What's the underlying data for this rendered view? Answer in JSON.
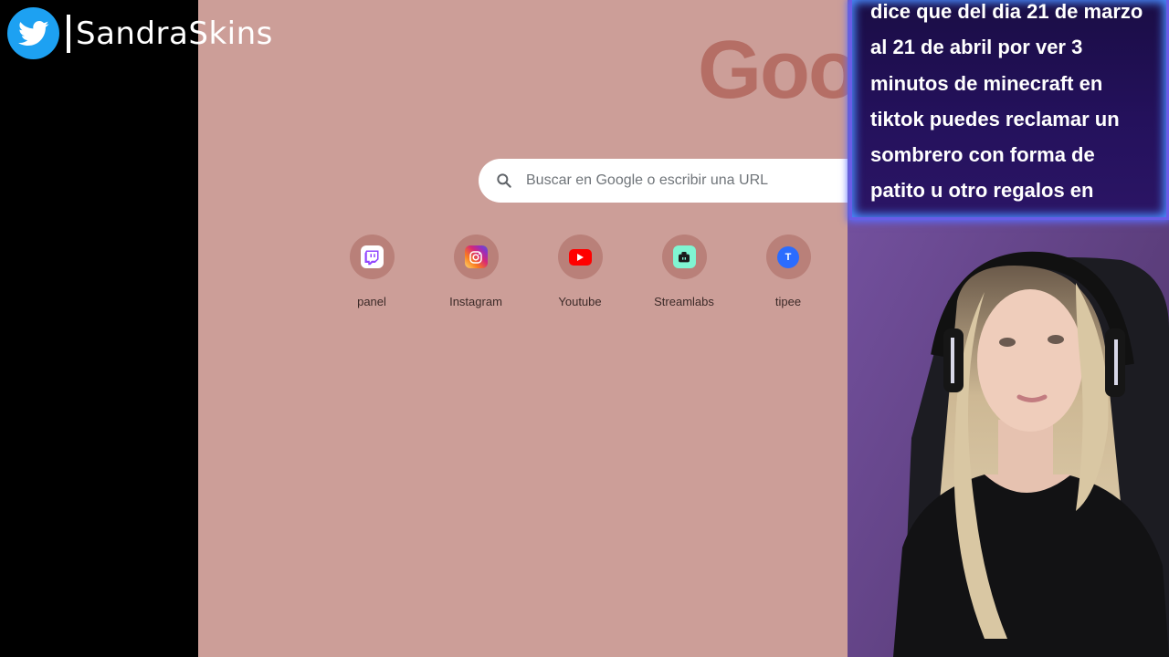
{
  "stream": {
    "twitter_handle": "SandraSkins",
    "overlay_message": "dice que del dia 21 de marzo al 21 de abril por ver 3 minutos de minecraft en tiktok puedes reclamar un sombrero con forma de patito u otro regalos en"
  },
  "browser": {
    "logo_text": "Goog",
    "search": {
      "placeholder": "Buscar en Google o escribir una URL",
      "value": ""
    },
    "shortcuts": [
      {
        "label": "panel",
        "icon": "twitch-icon",
        "color": "#9146ff"
      },
      {
        "label": "Instagram",
        "icon": "instagram-icon",
        "color": "#e1306c"
      },
      {
        "label": "Youtube",
        "icon": "youtube-icon",
        "color": "#ff0000"
      },
      {
        "label": "Streamlabs",
        "icon": "streamlabs-icon",
        "color": "#80f5d2"
      },
      {
        "label": "tipee",
        "icon": "tipee-icon",
        "color": "#2b6cff",
        "letter": "T"
      }
    ]
  },
  "colors": {
    "page_background": "#cc9e98",
    "shortcut_circle": "#b98079",
    "twitter_blue": "#1da1f2",
    "overlay_background": "#1f0f50",
    "overlay_border": "#6a5ce6"
  }
}
